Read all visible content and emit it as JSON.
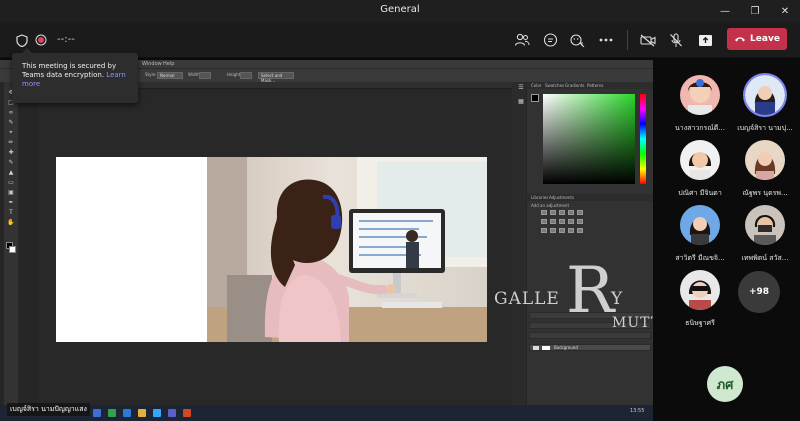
{
  "window": {
    "title": "General"
  },
  "meeting": {
    "timer": "--:--",
    "leave_label": "Leave"
  },
  "tooltip": {
    "text": "This meeting is secured by Teams data encryption.",
    "link": "Learn more"
  },
  "photoshop": {
    "menu_window": "Window",
    "menu_help": "Help",
    "option_style_label": "Style:",
    "option_style_value": "Normal",
    "option_width_label": "Width:",
    "option_height_label": "Height:",
    "option_select_mask": "Select and Mask...",
    "panel_tabs_top": [
      "Color",
      "Swatches",
      "Gradients",
      "Patterns"
    ],
    "panel_tabs_mid": [
      "Libraries",
      "Adjustments"
    ],
    "adjust_label": "Add an adjustment",
    "layer_background": "Background"
  },
  "shared_screen": {
    "presenter_name": "เบญจ์สิรา นามปัญญาแสง",
    "taskbar_time": "13:55"
  },
  "watermark": {
    "galle": "GALLE",
    "r": "R",
    "y": "Y",
    "mutt": "MUTT"
  },
  "participants": [
    {
      "name": "นางสาวกรณ์ดี..."
    },
    {
      "name": "เบญจ์สิรา นามปุ..."
    },
    {
      "name": "ปณิศา มีจินดา"
    },
    {
      "name": "ณัฐพร นุดรพ..."
    },
    {
      "name": "สาวิตรี มีณขจิ..."
    },
    {
      "name": "เทพพิตน์ สวัส..."
    },
    {
      "name": "ธนิษฐาศรี"
    }
  ],
  "more_count": "+98",
  "self_initials": "ภศ",
  "colors": {
    "leave": "#c4314b",
    "teams_accent": "#7f85f5",
    "self_avatar_bg": "#cfe8d0"
  }
}
